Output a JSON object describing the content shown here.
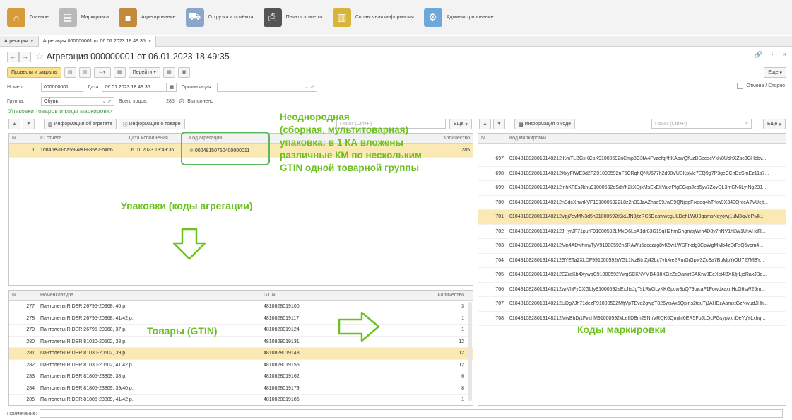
{
  "nav": [
    {
      "label": "Главное",
      "icon": "home-icon",
      "color": "#d89b3a"
    },
    {
      "label": "Маркировка",
      "icon": "clipboard-icon",
      "color": "#b9b9b9"
    },
    {
      "label": "Агрегирование",
      "icon": "box-icon",
      "color": "#c48a3c"
    },
    {
      "label": "Отгрузка и приёмка",
      "icon": "truck-icon",
      "color": "#8aa6c8"
    },
    {
      "label": "Печать этикеток",
      "icon": "printer-icon",
      "color": "#555555"
    },
    {
      "label": "Справочная информация",
      "icon": "books-icon",
      "color": "#d9b43a"
    },
    {
      "label": "Администрирование",
      "icon": "admin-icon",
      "color": "#6ea8d8"
    }
  ],
  "tabs": [
    {
      "label": "Агрегация"
    },
    {
      "label": "Агрегация 000000001 от 06.01.2023 18:49:35"
    }
  ],
  "doc": {
    "title": "Агрегация 000000001 от 06.01.2023 18:49:35",
    "post_close": "Провести и закрыть",
    "goto": "Перейти",
    "more": "Еще",
    "number_label": "Номер:",
    "number": "000000001",
    "date_label": "Дата:",
    "date": "06.01.2023 18:49:35",
    "org_label": "Организация:",
    "org": "",
    "cancel_status": "Отмена / Сторно",
    "group_label": "Группа:",
    "group": "Обувь",
    "total_label": "Всего кодов:",
    "total": "285",
    "status": "Выполнено",
    "section_title": "Упаковки товаров и коды маркировки"
  },
  "aggr": {
    "info_btn": "Информация об агрегате",
    "info_goods_btn": "Информация о товаре",
    "search_placeholder": "Поиск (Ctrl+F)",
    "more": "Еще",
    "headers": [
      "N",
      "ID отчета",
      "Дата исполнения",
      "Код агрегации",
      "Количество"
    ],
    "rows": [
      {
        "n": "1",
        "id": "1dd46e20-da59-4e09-85e7-b466...",
        "date": "06.01.2023 18:49:35",
        "code": "00048150750400000011",
        "qty": "285"
      }
    ]
  },
  "codes": {
    "info_btn": "Информация о коде",
    "search_placeholder": "Поиск (Ctrl+F)",
    "more": "Еще",
    "headers": [
      "N",
      "Код маркировки"
    ],
    "rows": [
      {
        "n": "697",
        "code": "0104810828019148212iKmTLBGxKCpK91000592nCmp8C3fA4Pvzefqf\\ftKAowQfUzBSeescVkN8UdnXZsc3GHbbv..."
      },
      {
        "n": "698",
        "code": "0104810828019148212XxyFtWE3d2FZ91000592nF5CRqhQNU677h2d98VUBKpMe7EQ9g7P3gcCChDxSmEz11s7..."
      },
      {
        "n": "699",
        "code": "0104810828019148212jnhKFEsJkhu91000592dSdYh2kXQjkMsExEkVakrPfgEGqsJed5yv7ZoyQL3mCN6LytNg23J..."
      },
      {
        "n": "700",
        "code": "0104810828019148212nSdcXhwrkVF1910005922L8z2n39JzAZhse99JwS9QNjepFixoqq4hTrkw9X343QrccA7VUcjt..."
      },
      {
        "n": "701",
        "code": "0104810828019148212Vpj7evMN3d5h91000592tSxLJN3jtzRC6DeawwcgULDehLWU9qamsNqyowj1uM3qVqPMk..."
      },
      {
        "n": "702",
        "code": "0104810828019148212JHyrJF71purF91000592LMxQ6LpA1dr83G19qH2hmGhgmbjWrn4D8y7nNV1hLW1UrAHdR..."
      },
      {
        "n": "703",
        "code": "0104810828019148212Mn4ADwhmyTyV91000592n6RAWu5acczzg8vK5w1WSFrkdg3CpWgMMb4zQiFsQ5vcm4..."
      },
      {
        "n": "704",
        "code": "0104810828019148212SYETa2XLDF991000592WGL1NzBtnZj42Lc7vhXie2RmGiGpw3ZcBa7BpMpYiOU727MBY..."
      },
      {
        "n": "705",
        "code": "0104810828019148212EZraKb4XywqC91000592YwgSCKNVMB4j38XGzZcQamrtSAKrw8EeXct4BXKfjfLjdRaxJBq..."
      },
      {
        "n": "706",
        "code": "0104810828019148212wrVhFyCXGLfy91000592sExJtsJgTsLRvGLyKKGpcw8oQ79pjcaF1FowdxaxnHcG6sW25m..."
      },
      {
        "n": "707",
        "code": "0104810828019148212UDg7Jh71dezP91000592MfjVpTEvo2gwpT826wsAx5Qpjns2tquTjJAHEzAamxtGzNwudJHh..."
      },
      {
        "n": "708",
        "code": "0104810828019148212MwBhDj1FvzhM91000592kLeffDBm29NhVRQK6QmjhI6ER5FbJLQcPGsypyxhDeYqYLxhq..."
      }
    ],
    "selected": "701"
  },
  "goods": {
    "headers": [
      "N",
      "Номенклатура",
      "GTIN",
      "Количество"
    ],
    "rows": [
      {
        "n": "277",
        "name": "Пантолеты RIDER 26795-20968, 40 р.",
        "gtin": "4810828019100",
        "qty": "3"
      },
      {
        "n": "278",
        "name": "Пантолеты RIDER 26795-20968, 41/42 р.",
        "gtin": "4810828019117",
        "qty": "1"
      },
      {
        "n": "279",
        "name": "Пантолеты RIDER 26795-20968, 37 р.",
        "gtin": "4810828019124",
        "qty": "1"
      },
      {
        "n": "280",
        "name": "Пантолеты RIDER 81030-20502, 38 р.",
        "gtin": "4810828019131",
        "qty": "12"
      },
      {
        "n": "281",
        "name": "Пантолеты RIDER 81030-20502, 39 р.",
        "gtin": "4810828019148",
        "qty": "12"
      },
      {
        "n": "282",
        "name": "Пантолеты RIDER 81030-20502, 41,42 р.",
        "gtin": "4810828019155",
        "qty": "12"
      },
      {
        "n": "283",
        "name": "Пантолеты RIDER 81805-23809, 38 р.",
        "gtin": "4810828019162",
        "qty": "6"
      },
      {
        "n": "284",
        "name": "Пантолеты RIDER 81805-23809, 39/40 р.",
        "gtin": "4810828019179",
        "qty": "8"
      },
      {
        "n": "285",
        "name": "Пантолеты RIDER 81805-23809, 41/42 р.",
        "gtin": "4810828019186",
        "qty": "1"
      }
    ],
    "selected": "281"
  },
  "note_label": "Примечание:",
  "annotations": {
    "mixed": "Неоднородная\n(сборная, мультитоварная)\nупаковка: в 1 КА вложены\nразличные КМ по нескольким\nGTIN одной товарной группы",
    "packages": "Упаковки (коды агрегации)",
    "goods": "Товары (GTIN)",
    "codes": "Коды маркировки"
  }
}
